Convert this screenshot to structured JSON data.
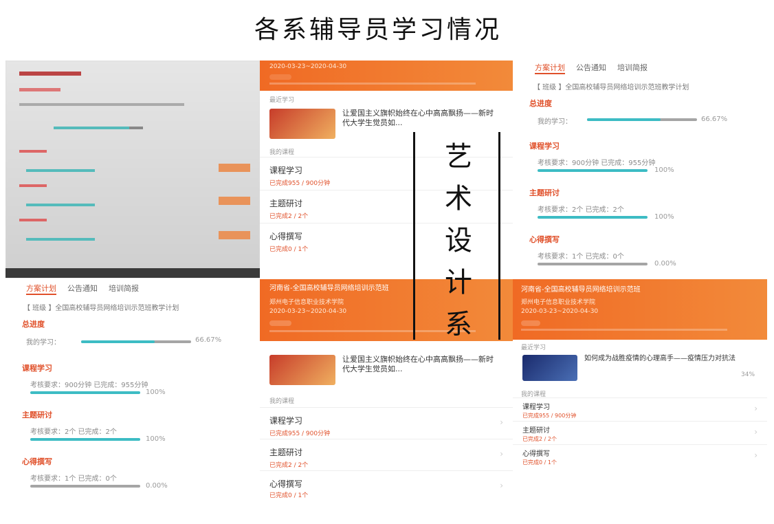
{
  "title": "各系辅导员学习情况",
  "department": [
    "艺",
    "术",
    "设",
    "计",
    "系"
  ],
  "tabs": [
    "方案计划",
    "公告通知",
    "培训简报"
  ],
  "program": "【 班级 】全国高校辅导员网络培训示范班教学计划",
  "overall": {
    "label": "总进度",
    "text": "我的学习：",
    "percent": "66.67%",
    "value": 0.6667
  },
  "sections": [
    {
      "label": "课程学习",
      "text": "考核要求：900分钟 已完成：955分钟",
      "percent": "100%",
      "value": 1.0
    },
    {
      "label": "主题研讨",
      "text": "考核要求：2个 已完成：2个",
      "percent": "100%",
      "value": 1.0
    },
    {
      "label": "心得撰写",
      "text": "考核要求：1个 已完成：0个",
      "percent": "0.00%",
      "value": 0.0
    }
  ],
  "banner": {
    "org": "河南省-全国高校辅导员网络培训示范班",
    "school": "郑州电子信息职业技术学院",
    "dates": "2020-03-23~2020-04-30"
  },
  "recent_label": "最近学习",
  "mycourse_label": "我的课程",
  "course_1": {
    "title": "让爱国主义旗帜始终在心中高高飘扬——新时代大学生觉员如..."
  },
  "course_2": {
    "title": "如何成为战胜疫情的心理高手——疫情压力对抗法",
    "percent": "34%"
  },
  "items": [
    {
      "name": "课程学习",
      "sub": "已完成955 / 900分钟"
    },
    {
      "name": "主题研讨",
      "sub": "已完成2 / 2个"
    },
    {
      "name": "心得撰写",
      "sub": "已完成0 / 1个"
    }
  ],
  "colors": {
    "accent": "#e0502a",
    "teal": "#3dbcc4",
    "gray": "#a5a5a5",
    "orange": "#f06a24"
  }
}
